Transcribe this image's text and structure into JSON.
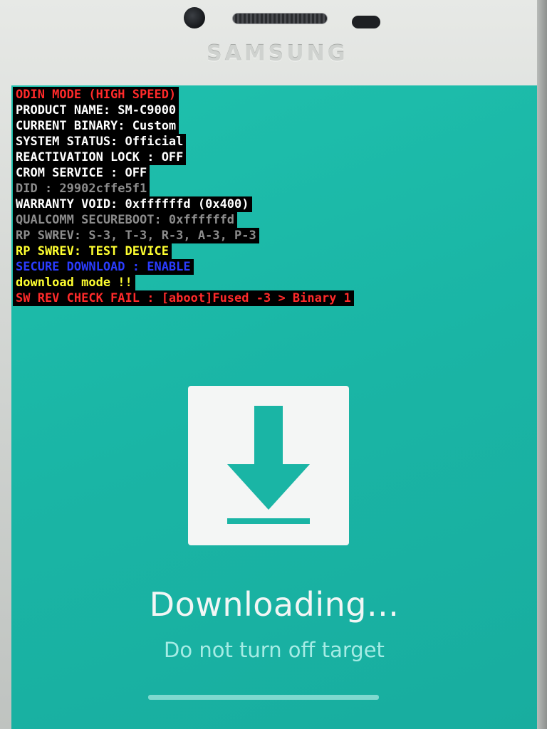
{
  "device": {
    "brand": "SAMSUNG"
  },
  "odin_log": [
    {
      "text": "ODIN MODE (HIGH SPEED)",
      "color": "#ff2a2a"
    },
    {
      "text": "PRODUCT NAME: SM-C9000",
      "color": "#ffffff"
    },
    {
      "text": "CURRENT BINARY: Custom",
      "color": "#ffffff"
    },
    {
      "text": "SYSTEM STATUS: Official",
      "color": "#ffffff"
    },
    {
      "text": "REACTIVATION LOCK : OFF",
      "color": "#ffffff"
    },
    {
      "text": "CROM SERVICE : OFF",
      "color": "#ffffff"
    },
    {
      "text": "DID : 29902cffe5f1",
      "color": "#8c8c8c"
    },
    {
      "text": "WARRANTY VOID: 0xffffffd (0x400)",
      "color": "#ffffff"
    },
    {
      "text": "QUALCOMM SECUREBOOT: 0xffffffd",
      "color": "#8c8c8c"
    },
    {
      "text": "RP SWREV: S-3, T-3, R-3, A-3, P-3",
      "color": "#8c8c8c"
    },
    {
      "text": "RP SWREV: TEST DEVICE",
      "color": "#ffff30"
    },
    {
      "text": "SECURE DOWNLOAD : ENABLE",
      "color": "#2a3cff"
    },
    {
      "text": "download mode !!",
      "color": "#ffff30"
    },
    {
      "text": "SW REV CHECK FAIL : [aboot]Fused -3 > Binary 1",
      "color": "#ff2a2a"
    }
  ],
  "status": {
    "title": "Downloading...",
    "subtitle": "Do not turn off target",
    "progress": 0.0,
    "icon": "download-arrow-icon"
  },
  "colors": {
    "screen_bg": "#1ab5a5",
    "icon_tile": "#f4f6f5",
    "icon_arrow": "#1ab5a5"
  }
}
